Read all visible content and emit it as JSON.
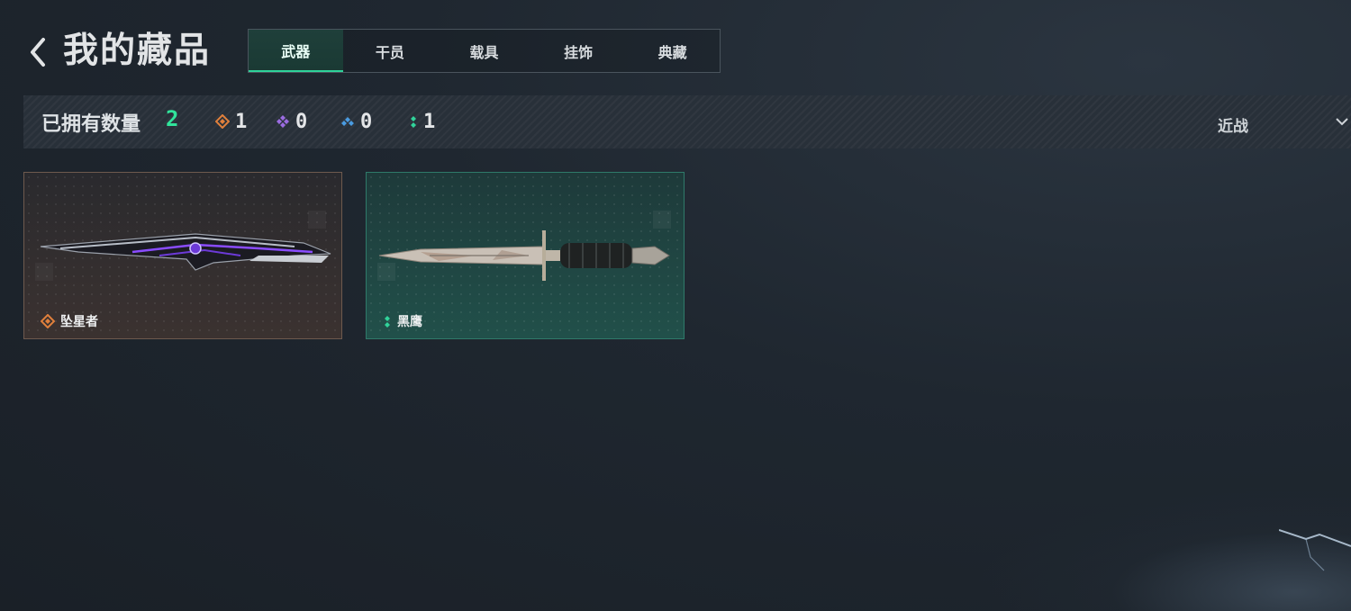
{
  "header": {
    "title": "我的藏品",
    "tabs": [
      {
        "label": "武器",
        "active": true
      },
      {
        "label": "干员",
        "active": false
      },
      {
        "label": "载具",
        "active": false
      },
      {
        "label": "挂饰",
        "active": false
      },
      {
        "label": "典藏",
        "active": false
      }
    ]
  },
  "filter": {
    "owned_label": "已拥有数量",
    "owned_count": "2",
    "rarities": [
      {
        "icon": "orange-diamond-icon",
        "color": "#e0803c",
        "count": "1"
      },
      {
        "icon": "purple-diamond-icon",
        "color": "#9b6ce0",
        "count": "0"
      },
      {
        "icon": "blue-diamond-icon",
        "color": "#4a9be0",
        "count": "0"
      },
      {
        "icon": "green-dots-icon",
        "color": "#31d39a",
        "count": "1"
      }
    ],
    "category": "近战"
  },
  "items": [
    {
      "name": "坠星者",
      "rarity_color": "#e0803c",
      "theme": "orange"
    },
    {
      "name": "黑鹰",
      "rarity_color": "#31d39a",
      "theme": "green"
    }
  ],
  "colors": {
    "accent": "#2ed39a",
    "background": "#1f2730"
  }
}
